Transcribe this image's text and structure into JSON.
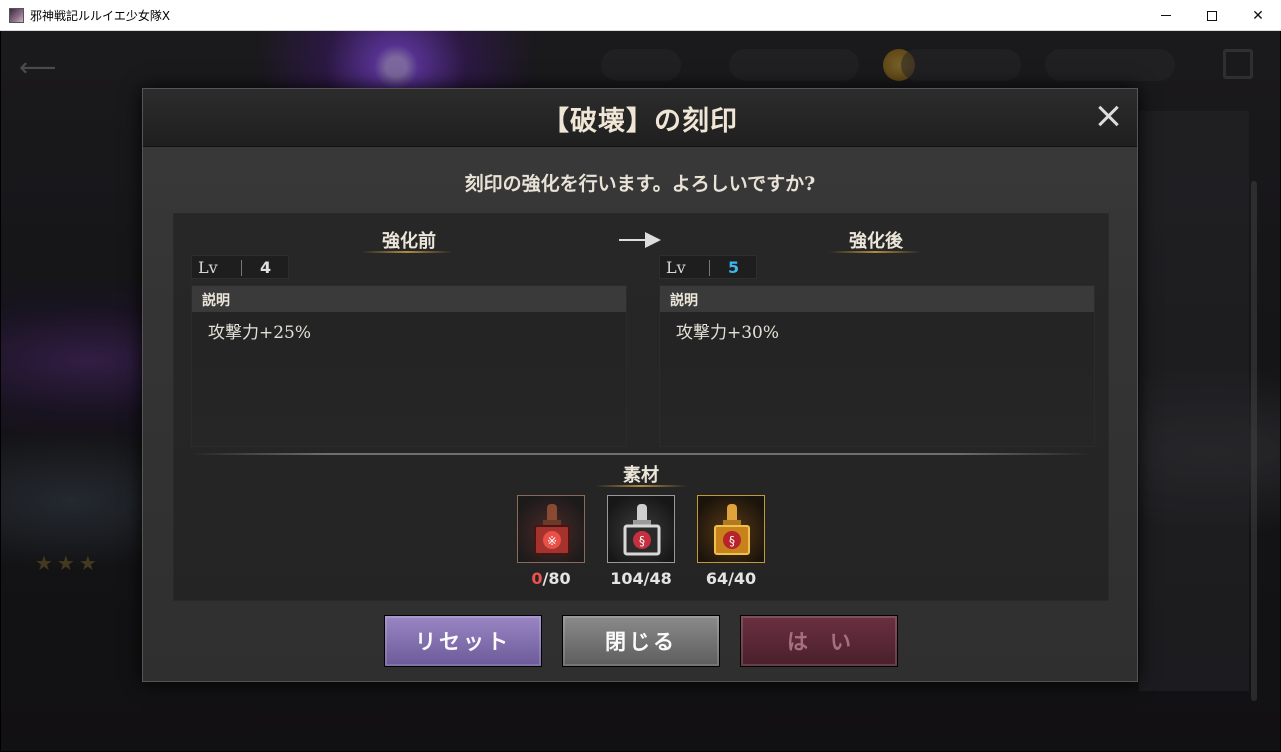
{
  "window": {
    "title": "邪神戦記ルルイエ少女隊X"
  },
  "dialog": {
    "title": "【破壊】の刻印",
    "confirm_text": "刻印の強化を行います。よろしいですか?",
    "before": {
      "heading": "強化前",
      "lv_label": "Lv",
      "lv_value": "4",
      "desc_heading": "説明",
      "desc_text": "攻撃力+25%"
    },
    "after": {
      "heading": "強化後",
      "lv_label": "Lv",
      "lv_value": "5",
      "desc_heading": "説明",
      "desc_text": "攻撃力+30%"
    },
    "materials": {
      "heading": "素材",
      "items": [
        {
          "icon": "red-stamp-icon",
          "have": "0",
          "need": "/80"
        },
        {
          "icon": "silver-stamp-icon",
          "have": "104",
          "need": "/48"
        },
        {
          "icon": "gold-stamp-icon",
          "have": "64",
          "need": "/40"
        }
      ]
    },
    "buttons": {
      "reset": "リセット",
      "close": "閉じる",
      "yes": "はい"
    }
  },
  "colors": {
    "level_after": "#3fb6e8",
    "insufficient": "#ef5050",
    "reset_button": "#7d6aa8",
    "yes_button": "#5a2836"
  }
}
